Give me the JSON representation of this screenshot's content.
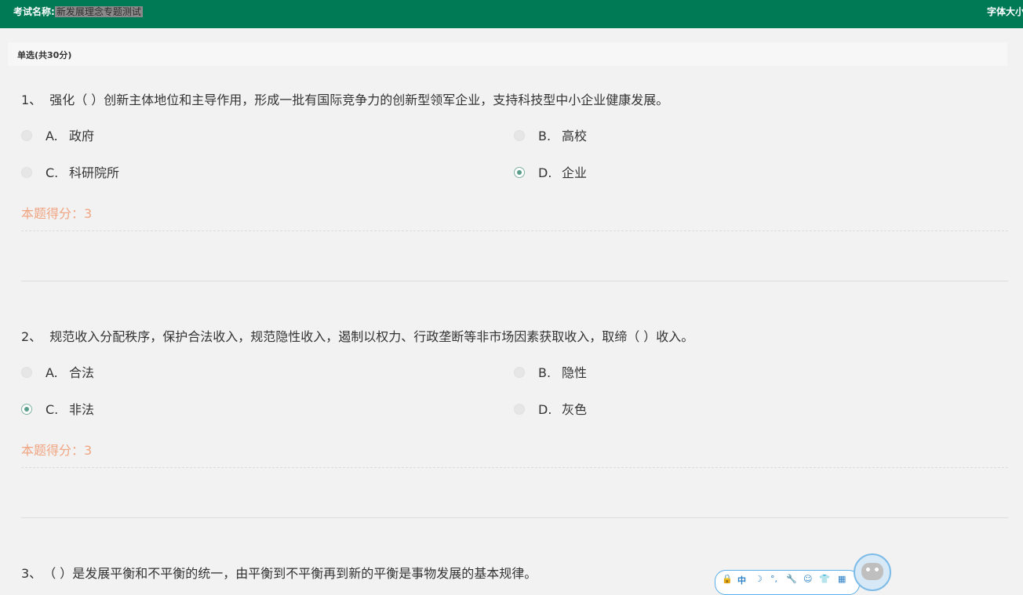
{
  "header": {
    "exam_label": "考试名称:",
    "exam_name": "新发展理念专题测试",
    "font_size_label": "字体大小"
  },
  "section": {
    "title": "单选(共30分)"
  },
  "questions": [
    {
      "number": "1、",
      "stem": "强化（ ）创新主体地位和主导作用，形成一批有国际竞争力的创新型领军企业，支持科技型中小企业健康发展。",
      "options": [
        {
          "letter": "A.",
          "text": "政府",
          "selected": false
        },
        {
          "letter": "B.",
          "text": "高校",
          "selected": false
        },
        {
          "letter": "C.",
          "text": "科研院所",
          "selected": false
        },
        {
          "letter": "D.",
          "text": "企业",
          "selected": true
        }
      ],
      "score": "本题得分：3"
    },
    {
      "number": "2、",
      "stem": "规范收入分配秩序，保护合法收入，规范隐性收入，遏制以权力、行政垄断等非市场因素获取收入，取缔（ ）收入。",
      "options": [
        {
          "letter": "A.",
          "text": "合法",
          "selected": false
        },
        {
          "letter": "B.",
          "text": "隐性",
          "selected": false
        },
        {
          "letter": "C.",
          "text": "非法",
          "selected": true
        },
        {
          "letter": "D.",
          "text": "灰色",
          "selected": false
        }
      ],
      "score": "本题得分：3"
    },
    {
      "number": "3、",
      "stem": "（ ）是发展平衡和不平衡的统一，由平衡到不平衡再到新的平衡是事物发展的基本规律。"
    }
  ],
  "widget": {
    "icons": [
      "lock-icon",
      "zhong-icon",
      "moon-icon",
      "punctuation-icon",
      "wrench-icon",
      "emoji-icon",
      "shirt-icon",
      "grid-icon"
    ],
    "labels": [
      "🔒",
      "中",
      "☽",
      "°,",
      "🔧",
      "☺",
      "👕",
      "▦"
    ]
  },
  "colors": {
    "header_bg": "#007a55",
    "score_text": "#f0a583",
    "radio_checked": "#5a9d8a"
  }
}
